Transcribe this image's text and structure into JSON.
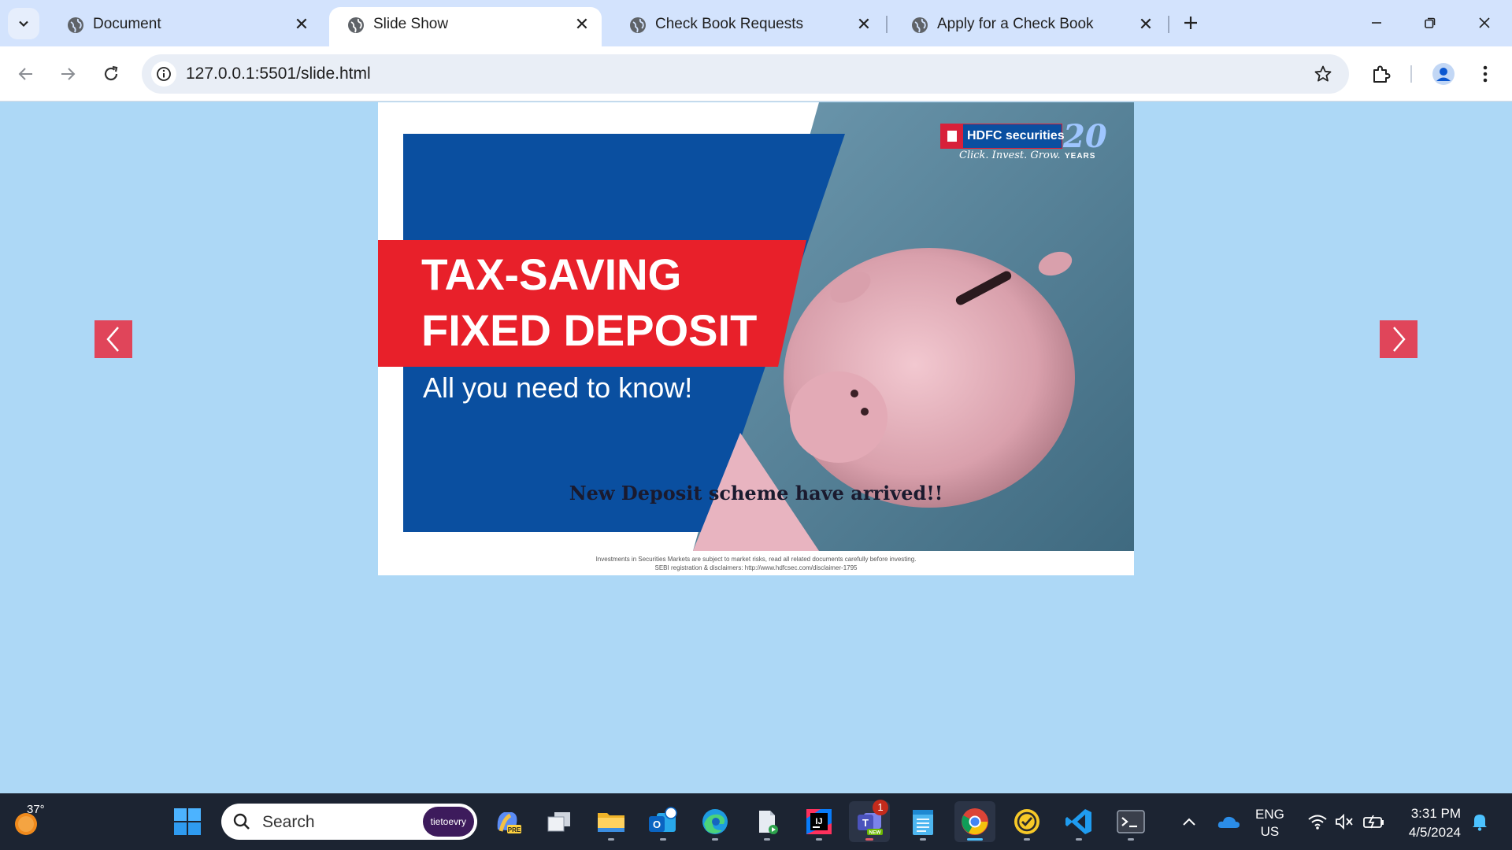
{
  "browser": {
    "tabs": [
      {
        "title": "Document",
        "active": false
      },
      {
        "title": "Slide Show",
        "active": true
      },
      {
        "title": "Check Book Requests",
        "active": false
      },
      {
        "title": "Apply for a Check Book",
        "active": false
      }
    ],
    "address": "127.0.0.1:5501/slide.html"
  },
  "slide": {
    "brand": "HDFC securities",
    "brand_tagline": "Click. Invest. Grow.",
    "anniversary": "20",
    "anniversary_label": "YEARS",
    "headline_line1": "TAX-SAVING",
    "headline_line2": "FIXED DEPOSIT",
    "subheadline": "All you need to know!",
    "caption": "New Deposit scheme have arrived!!",
    "disclaimer_line1": "Investments in Securities Markets are subject to market risks, read all related documents carefully before investing.",
    "disclaimer_line2": "SEBI registration & disclaimers: http://www.hdfcsec.com/disclaimer-1795",
    "colors": {
      "blue": "#0a4fa0",
      "red": "#e8202a",
      "teal": "#5d8aa0",
      "pink": "#e8b4c0",
      "arrow": "#e0455a"
    }
  },
  "taskbar": {
    "weather_temp": "37°",
    "search_placeholder": "Search",
    "search_badge": "tietoevry",
    "teams_badge": "1",
    "lang_line1": "ENG",
    "lang_line2": "US",
    "time": "3:31 PM",
    "date": "4/5/2024",
    "apps": [
      "copilot-icon",
      "task-view-icon",
      "file-explorer-icon",
      "outlook-icon",
      "edge-icon",
      "store-icon",
      "intellij-icon",
      "teams-icon",
      "notepad-icon",
      "chrome-icon",
      "norton-icon",
      "vscode-icon",
      "terminal-icon"
    ]
  }
}
